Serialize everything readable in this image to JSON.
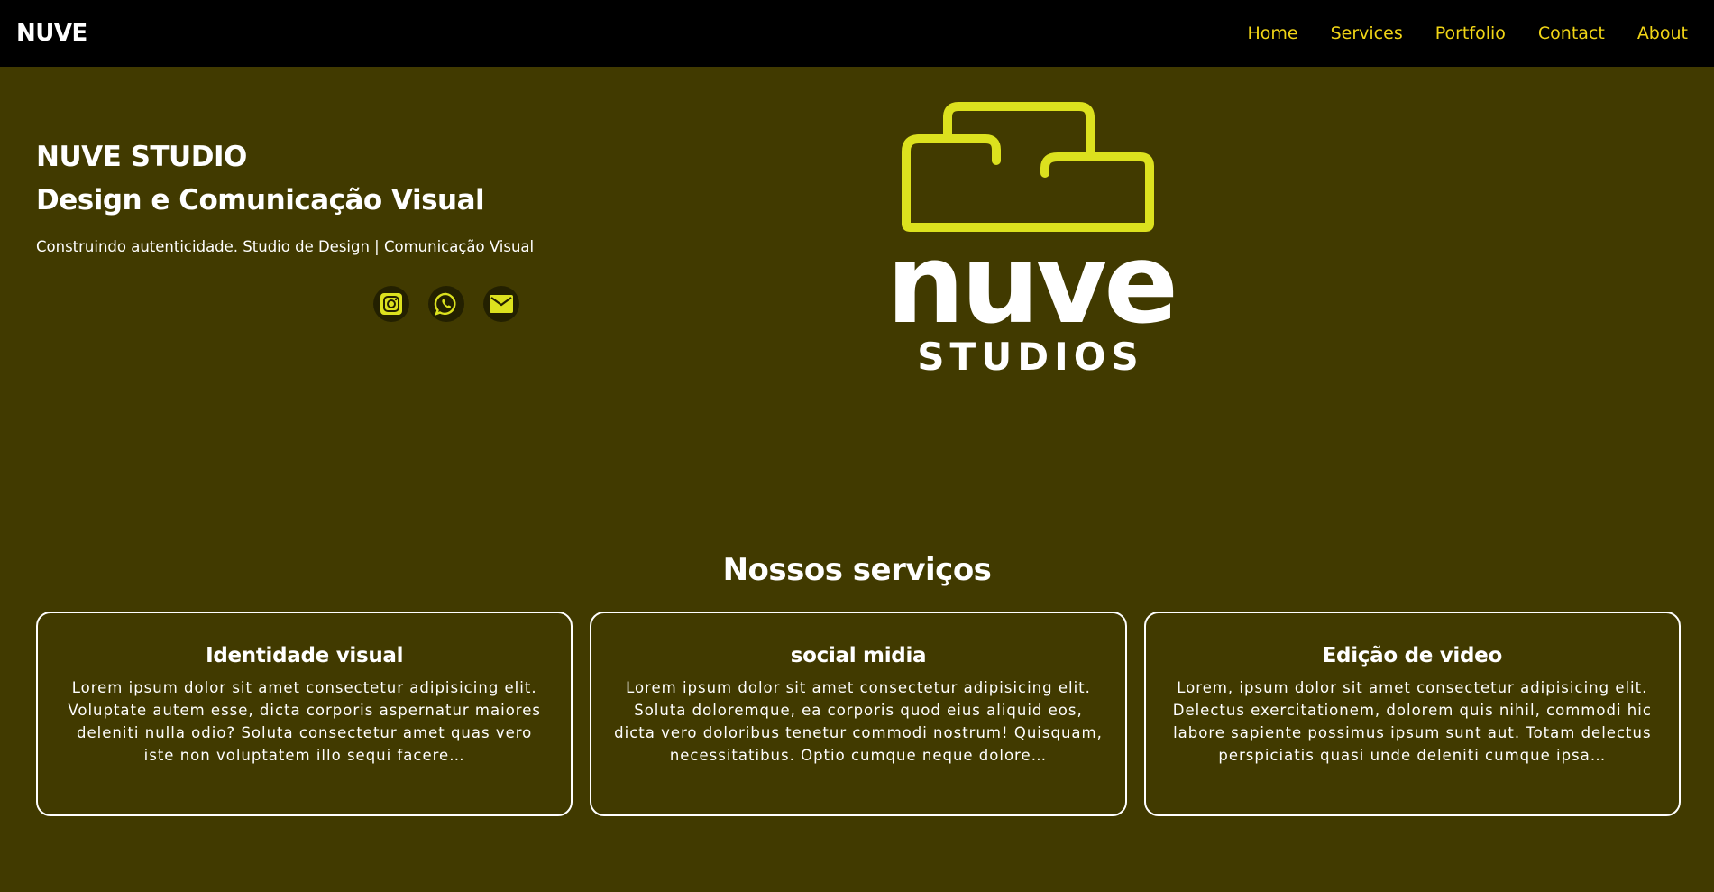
{
  "nav": {
    "brand": "NUVE",
    "links": [
      "Home",
      "Services",
      "Portfolio",
      "Contact",
      "About"
    ]
  },
  "hero": {
    "title_line1": "NUVE STUDIO",
    "title_line2": "Design e Comunicação Visual",
    "tagline": "Construindo autenticidade. Studio de Design | Comunicação Visual",
    "social_icons": [
      "instagram-icon",
      "whatsapp-icon",
      "email-icon"
    ]
  },
  "logo": {
    "word": "nuve",
    "sub": "STUDIOS"
  },
  "services": {
    "title": "Nossos serviços",
    "cards": [
      {
        "title": "Identidade visual",
        "text": "Lorem ipsum dolor sit amet consectetur adipisicing elit. Voluptate autem esse, dicta corporis aspernatur maiores deleniti nulla odio? Soluta consectetur amet quas vero iste non voluptatem illo sequi facere…"
      },
      {
        "title": "social midia",
        "text": "Lorem ipsum dolor sit amet consectetur adipisicing elit. Soluta doloremque, ea corporis quod eius aliquid eos, dicta vero doloribus tenetur commodi nostrum! Quisquam, necessitatibus. Optio cumque neque dolore…"
      },
      {
        "title": "Edição de video",
        "text": "Lorem, ipsum dolor sit amet consectetur adipisicing elit. Delectus exercitationem, dolorem quis nihil, commodi hic labore sapiente possimus ipsum sunt aut. Totam delectus perspiciatis quasi unde deleniti cumque ipsa…"
      }
    ]
  },
  "colors": {
    "background": "#413a00",
    "navbar": "#000000",
    "accent": "#dce11e",
    "nav_link": "#f1d516"
  }
}
